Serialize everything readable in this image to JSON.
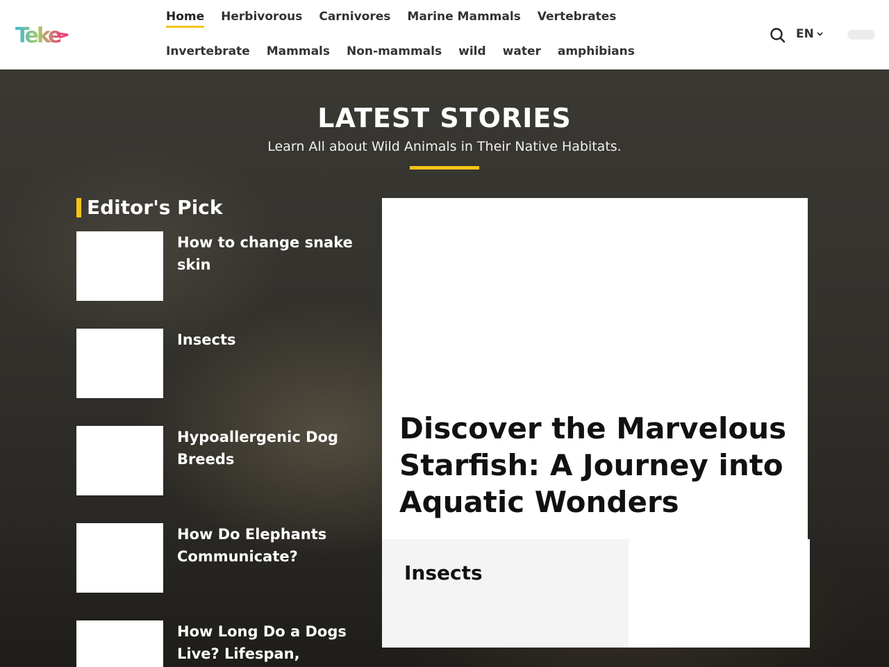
{
  "header": {
    "logo_text": "Teke",
    "nav_row1": [
      "Home",
      "Herbivorous",
      "Carnivores",
      "Marine Mammals",
      "Vertebrates"
    ],
    "nav_row2": [
      "Invertebrate",
      "Mammals",
      "Non-mammals",
      "wild",
      "water",
      "amphibians"
    ],
    "active_nav": "Home",
    "search_icon": "search-icon",
    "language": "EN",
    "accent_color": "#f5c518"
  },
  "hero": {
    "title": "LATEST STORIES",
    "subtitle": "Learn All about Wild Animals in Their Native Habitats."
  },
  "editors_pick": {
    "heading": "Editor's Pick",
    "items": [
      {
        "title": "How to change snake skin"
      },
      {
        "title": "Insects"
      },
      {
        "title": "Hypoallergenic Dog Breeds"
      },
      {
        "title": "How Do Elephants Communicate?"
      },
      {
        "title": "How Long Do a Dogs Live? Lifespan,"
      }
    ]
  },
  "featured": {
    "title": "Discover the Marvelous Starfish: A Journey into Aquatic Wonders"
  },
  "secondary": {
    "title": "Insects"
  }
}
